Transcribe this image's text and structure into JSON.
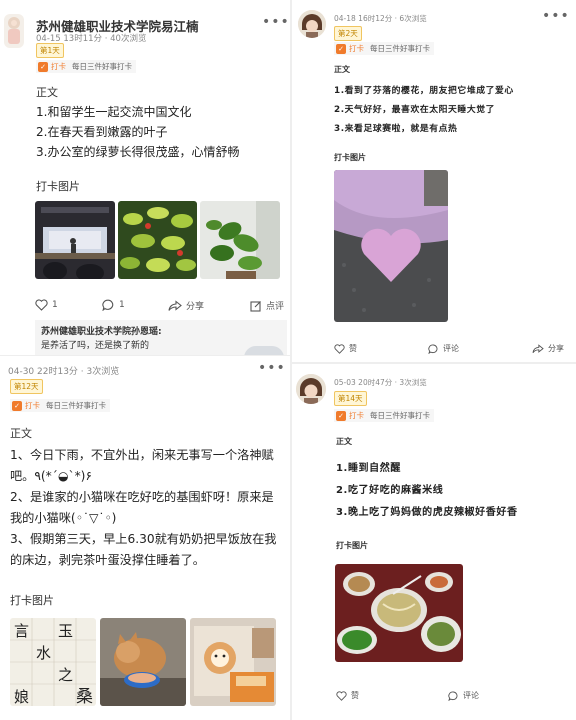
{
  "posts": [
    {
      "author": "苏州健雄职业技术学院易江楠",
      "meta": "04-15 13时11分 · 40次浏览",
      "badge": "第1天",
      "tag_label": "打卡",
      "tag_name": "每日三件好事打卡",
      "section_body": "正文",
      "lines": [
        "1.和留学生一起交流中国文化",
        "2.在春天看到嫩露的叶子",
        "3.办公室的绿萝长得很茂盛，心情舒畅"
      ],
      "section_photos": "打卡图片",
      "like_count": "1",
      "comment_count": "1",
      "share_label": "分享",
      "review_label": "点评",
      "reply_author": "苏州健雄职业技术学院孙恩瑶:",
      "reply_text": "是养活了吗，还是换了新的"
    },
    {
      "meta": "04-18 16时12分 · 6次浏览",
      "badge": "第2天",
      "tag_label": "打卡",
      "tag_name": "每日三件好事打卡",
      "section_body": "正文",
      "lines": [
        "1.看到了芬落的樱花，朋友把它堆成了爱心",
        "2.天气好好，最喜欢在太阳天睡大觉了",
        "3.来看足球赛啦，就是有点热"
      ],
      "section_photos": "打卡图片",
      "like_label": "赞",
      "comment_label": "评论",
      "share_label": "分享"
    },
    {
      "meta": "04-30 22时13分 · 3次浏览",
      "badge": "第12天",
      "tag_label": "打卡",
      "tag_name": "每日三件好事打卡",
      "section_body": "正文",
      "paragraph": "1、今日下雨，不宜外出，闲来无事写一个洛神赋吧。٩(*´◒`*)۶\n2、是谁家的小猫咪在吃好吃的基围虾呀！原来是我的小猫咪(◦˙▽˙◦)\n3、假期第三天，早上6.30就有奶奶把早饭放在我的床边，剥完茶叶蛋没撑住睡着了。",
      "section_photos": "打卡图片"
    },
    {
      "meta": "05-03 20时47分 · 3次浏览",
      "badge": "第14天",
      "tag_label": "打卡",
      "tag_name": "每日三件好事打卡",
      "section_body": "正文",
      "lines": [
        "1.睡到自然醒",
        "2.吃了好吃的麻酱米线",
        "3.晚上吃了妈妈做的虎皮辣椒好香好香"
      ],
      "section_photos": "打卡图片",
      "like_label": "赞",
      "comment_label": "评论"
    }
  ],
  "colors": {
    "accent": "#f07b2c",
    "badge": "#c08400",
    "badge_bg": "#fff6d6"
  }
}
